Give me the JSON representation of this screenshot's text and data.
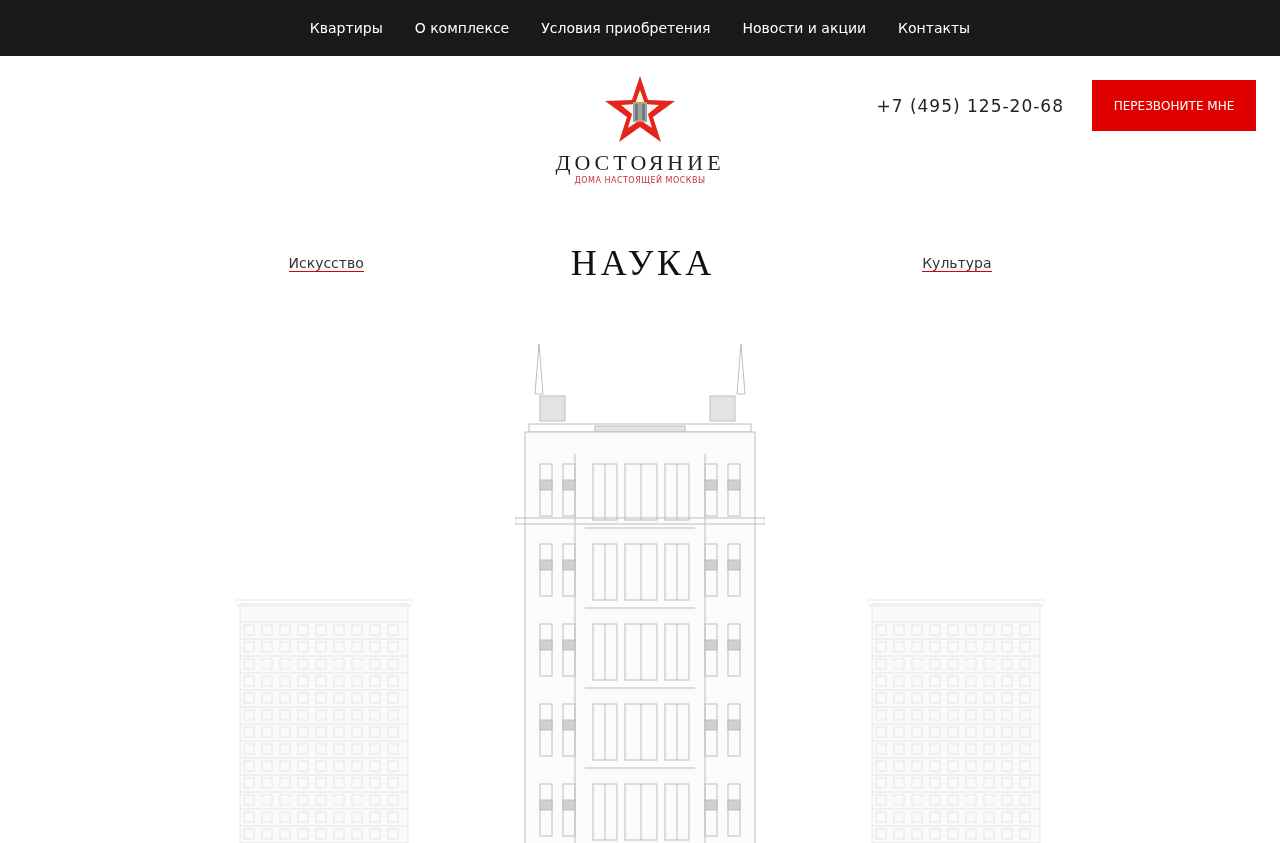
{
  "nav": [
    {
      "label": "Квартиры"
    },
    {
      "label": "О комплексе"
    },
    {
      "label": "Условия приобретения"
    },
    {
      "label": "Новости и акции"
    },
    {
      "label": "Контакты"
    }
  ],
  "logo": {
    "name": "ДОСТОЯНИЕ",
    "tagline": "ДОМА НАСТОЯЩЕЙ МОСКВЫ"
  },
  "phone": "+7 (495) 125-20-68",
  "callback_button": "ПЕРЕЗВОНИТЕ МНЕ",
  "section": {
    "prev": "Искусство",
    "title": "НАУКА",
    "next": "Культура"
  }
}
